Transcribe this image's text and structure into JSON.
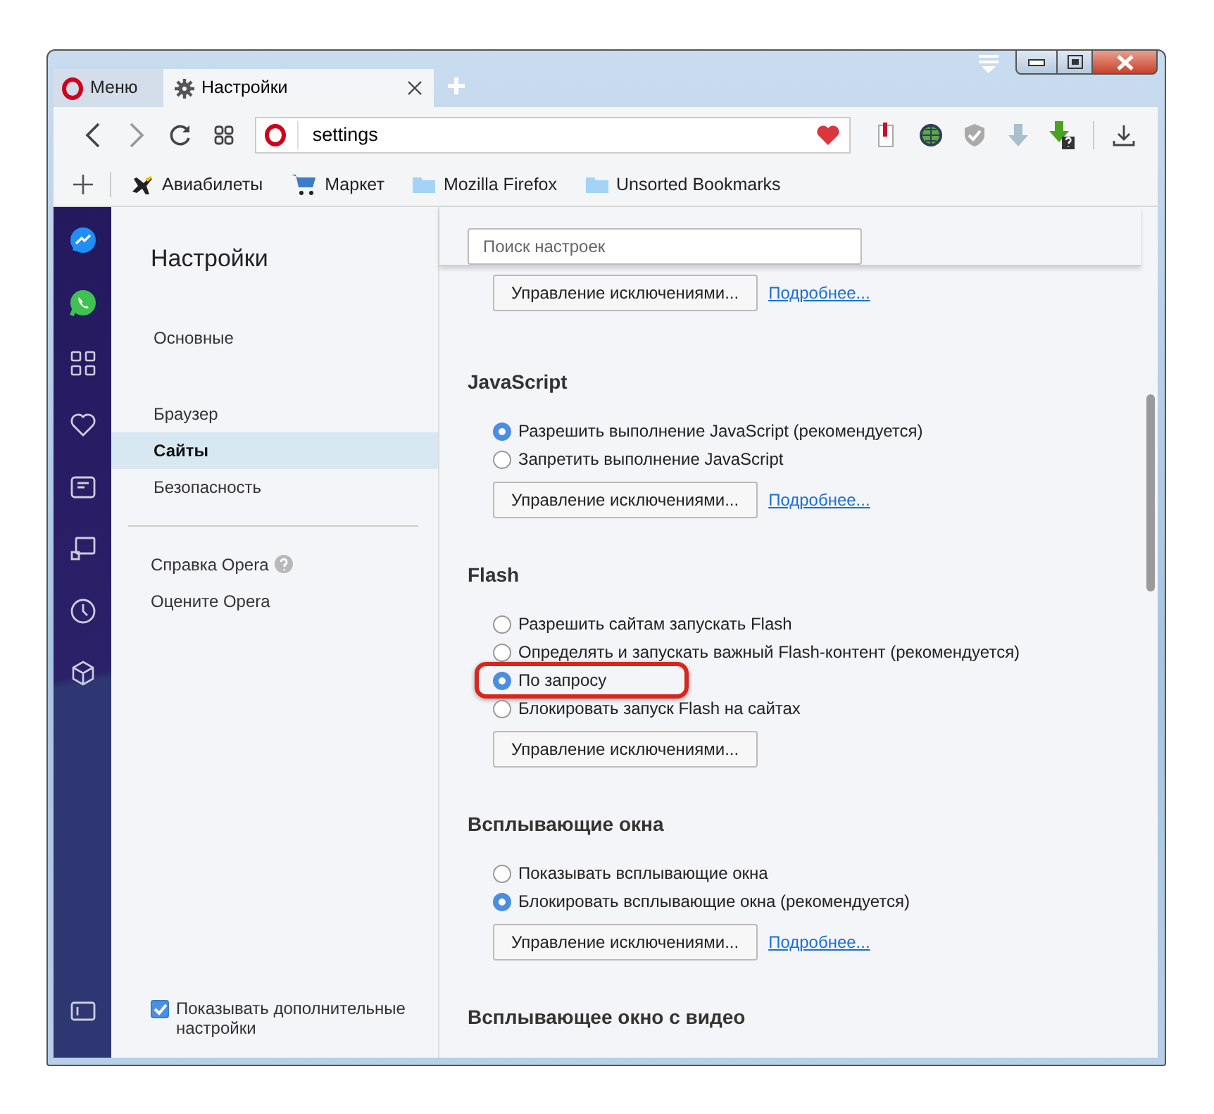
{
  "menu_button": {
    "label": "Меню"
  },
  "tabs": [
    {
      "label": "Настройки",
      "selected": true
    }
  ],
  "address_bar": {
    "value": "settings"
  },
  "bookmarks": [
    {
      "label": "Авиабилеты",
      "kind": "plane"
    },
    {
      "label": "Маркет",
      "kind": "cart"
    },
    {
      "label": "Mozilla Firefox",
      "kind": "folder"
    },
    {
      "label": "Unsorted Bookmarks",
      "kind": "folder"
    }
  ],
  "settings_nav": {
    "title": "Настройки",
    "groups": [
      [
        {
          "label": "Основные",
          "selected": false
        }
      ],
      [
        {
          "label": "Браузер",
          "selected": false
        },
        {
          "label": "Сайты",
          "selected": true
        },
        {
          "label": "Безопасность",
          "selected": false
        }
      ],
      [
        {
          "label": "Справка Opera",
          "selected": false,
          "help": true
        },
        {
          "label": "Оцените Opera",
          "selected": false,
          "help": false
        }
      ]
    ],
    "advanced": {
      "label": "Показывать дополнительные настройки",
      "checked": true
    }
  },
  "search": {
    "placeholder": "Поиск настроек"
  },
  "sections": [
    {
      "button": "Управление исключениями...",
      "link": "Подробнее..."
    },
    {
      "title": "JavaScript",
      "options": [
        {
          "label": "Разрешить выполнение JavaScript (рекомендуется)",
          "selected": true,
          "highlighted": false
        },
        {
          "label": "Запретить выполнение JavaScript",
          "selected": false,
          "highlighted": false
        }
      ],
      "button": "Управление исключениями...",
      "link": "Подробнее..."
    },
    {
      "title": "Flash",
      "options": [
        {
          "label": "Разрешить сайтам запускать Flash",
          "selected": false,
          "highlighted": false
        },
        {
          "label": "Определять и запускать важный Flash-контент (рекомендуется)",
          "selected": false,
          "highlighted": false
        },
        {
          "label": "По запросу",
          "selected": true,
          "highlighted": true
        },
        {
          "label": "Блокировать запуск Flash на сайтах",
          "selected": false,
          "highlighted": false
        }
      ],
      "button": "Управление исключениями..."
    },
    {
      "title": "Всплывающие окна",
      "options": [
        {
          "label": "Показывать всплывающие окна",
          "selected": false,
          "highlighted": false
        },
        {
          "label": "Блокировать всплывающие окна (рекомендуется)",
          "selected": true,
          "highlighted": false
        }
      ],
      "button": "Управление исключениями...",
      "link": "Подробнее..."
    },
    {
      "title": "Всплывающее окно с видео"
    }
  ]
}
